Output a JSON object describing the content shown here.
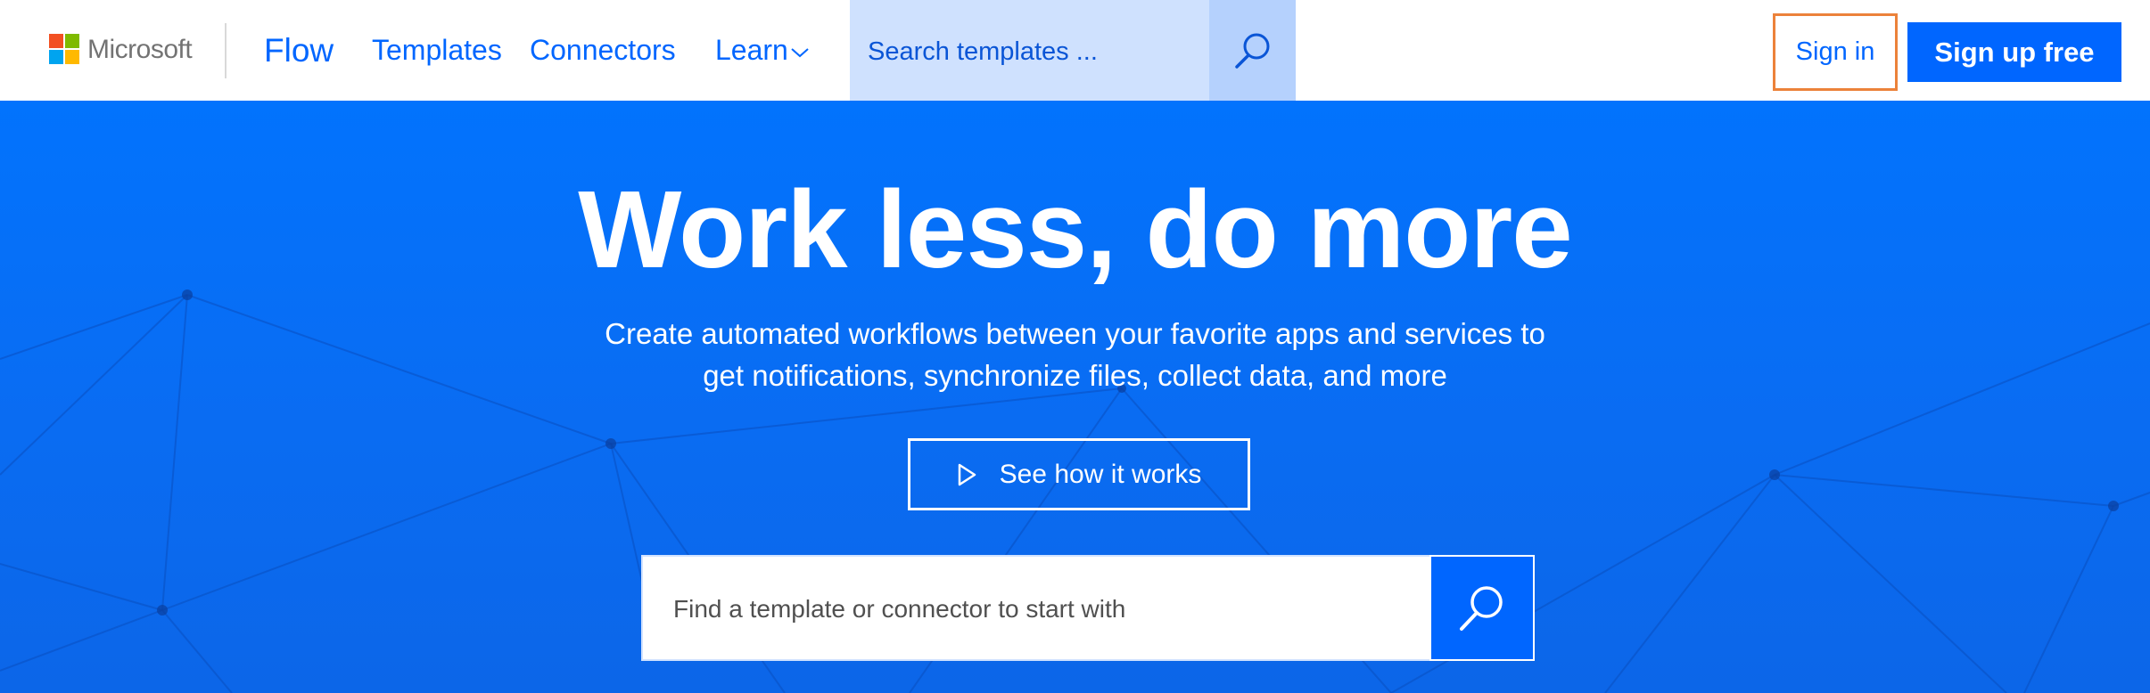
{
  "header": {
    "brand": "Microsoft",
    "brand_colors": [
      "#f25022",
      "#7fba00",
      "#00a4ef",
      "#ffb900"
    ],
    "nav": {
      "flow_label": "Flow",
      "templates_label": "Templates",
      "connectors_label": "Connectors",
      "learn_label": "Learn"
    },
    "search": {
      "placeholder": "Search templates ..."
    },
    "sign_in_label": "Sign in",
    "sign_up_label": "Sign up free"
  },
  "hero": {
    "title": "Work less, do more",
    "subtitle_line1": "Create automated workflows between your favorite apps and services to",
    "subtitle_line2": "get notifications, synchronize files, collect data, and more",
    "see_how_label": "See how it works",
    "search_placeholder": "Find a template or connector to start with"
  },
  "colors": {
    "accent": "#0066ff",
    "highlight_border": "#ec823a",
    "search_bg": "#cfe1fe",
    "search_btn_bg": "#b5d1fd",
    "hero_bg": "#0273fd"
  }
}
